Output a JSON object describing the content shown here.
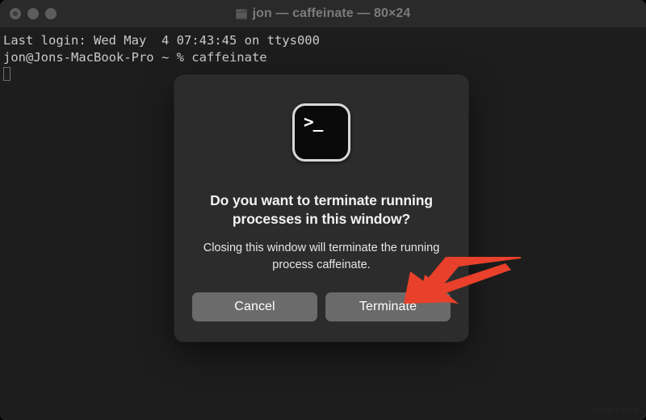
{
  "window": {
    "title": "jon — caffeinate — 80×24",
    "title_icon": "terminal-folder-icon",
    "traffic_lights": [
      {
        "name": "close",
        "color": "#5d5d5d"
      },
      {
        "name": "minimize",
        "color": "#5d5d5d"
      },
      {
        "name": "zoom",
        "color": "#5d5d5d"
      }
    ]
  },
  "terminal": {
    "lines": [
      "Last login: Wed May  4 07:43:45 on ttys000",
      "jon@Jons-MacBook-Pro ~ % caffeinate"
    ],
    "cursor": "block-outline",
    "background": "#1d1d1d",
    "foreground": "#c9c9c9"
  },
  "dialog": {
    "app_icon": "terminal-app-icon",
    "app_icon_glyph": ">_",
    "title": "Do you want to terminate running processes in this window?",
    "message": "Closing this window will terminate the running process caffeinate.",
    "buttons": [
      {
        "label": "Cancel",
        "role": "cancel"
      },
      {
        "label": "Terminate",
        "role": "default"
      }
    ]
  },
  "annotation": {
    "arrow": "red-arrow-pointing-to-terminate",
    "color": "#e8402a"
  },
  "watermark": {
    "text": "wsxdn.com"
  }
}
